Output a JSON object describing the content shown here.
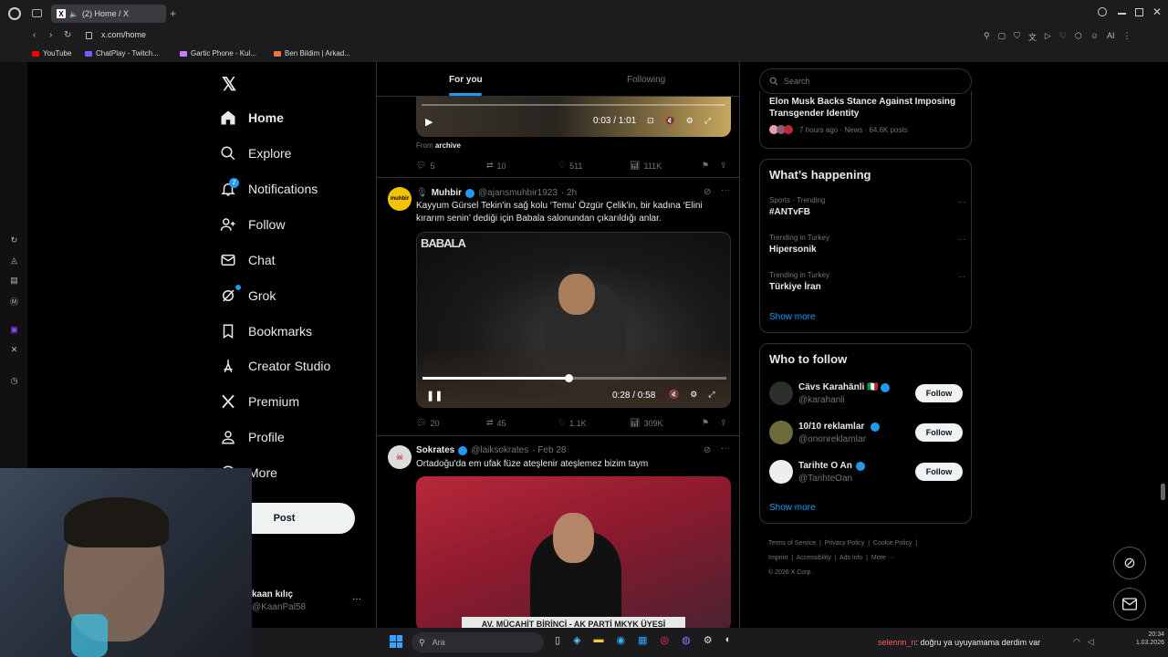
{
  "browser": {
    "tab_title": "(2) Home / X",
    "url": "x.com/home",
    "bookmarks": [
      "YouTube",
      "ChatPlay - Twitch...",
      "Gartic Phone - Kul...",
      "Ben Bildim | Arkad..."
    ],
    "ai_label": "AI"
  },
  "nav": {
    "items": [
      "Home",
      "Explore",
      "Notifications",
      "Follow",
      "Chat",
      "Grok",
      "Bookmarks",
      "Creator Studio",
      "Premium",
      "Profile",
      "More"
    ],
    "notifications_badge": "2",
    "post_label": "Post",
    "account_name": "kaan kılıç",
    "account_handle": "@KaanPal58",
    "account_more": "···"
  },
  "timeline": {
    "tabs": [
      "For you",
      "Following"
    ],
    "tweet1": {
      "time": "0:03 / 1:01",
      "from_prefix": "From",
      "from_source": "archive",
      "replies": "5",
      "reposts": "10",
      "likes": "511",
      "views": "111K"
    },
    "tweet2": {
      "name": "Muhbir",
      "handle": "@ajansmuhbir1923",
      "age": "· 2h",
      "text": "Kayyum Gürsel Tekin'in sağ kolu ‘Temu’ Özgür Çelik’in, bir kadına ‘Elini kırarım senin’ dediği için Babala salonundan çıkarıldığı anlar.",
      "video_logo": "BABALA",
      "video_time": "0:28 / 0:58",
      "progress": 0.48,
      "replies": "20",
      "reposts": "45",
      "likes": "1.1K",
      "views": "309K"
    },
    "tweet3": {
      "name": "Sokrates",
      "handle": "@laiksokrates",
      "age": "· Feb 28",
      "text": "Ortadoğu'da em ufak füze ateşlenir ateşlemez bizim taym",
      "caption": "AV. MÜCAHİT BİRİNCİ - AK PARTİ MKYK ÜYESİ"
    }
  },
  "right": {
    "search_placeholder": "Search",
    "news_title": "Elon Musk Backs Stance Against Imposing Transgender Identity",
    "news_meta": "7 hours ago · News · 64.6K posts",
    "happening_title": "What’s happening",
    "trends": [
      {
        "context": "Sports · Trending",
        "name": "#ANTvFB"
      },
      {
        "context": "Trending in Turkey",
        "name": "Hipersonik"
      },
      {
        "context": "Trending in Turkey",
        "name": "Türkiye İran"
      }
    ],
    "show_more": "Show more",
    "who_title": "Who to follow",
    "follow_label": "Follow",
    "suggestions": [
      {
        "name": "Cävs Karahänli 🇮🇹",
        "handle": "@karahanli"
      },
      {
        "name": "10/10 reklamlar",
        "handle": "@ononreklamIar"
      },
      {
        "name": "Tarihte O An",
        "handle": "@TarihteOan"
      }
    ],
    "footer": [
      "Terms of Service",
      "Privacy Policy",
      "Cookie Policy",
      "Imprint",
      "Accessibility",
      "Ads info",
      "More ···",
      "© 2026 X Corp."
    ]
  },
  "taskbar": {
    "search_placeholder": "Ara",
    "chat_user": "selennn_n",
    "chat_message": ": doğru ya uyuyamama derdim var",
    "clock": "20:34",
    "date": "1.03.2026"
  },
  "colors": {
    "accent": "#1d9bf0",
    "bg": "#000000",
    "border": "#2f3336"
  }
}
